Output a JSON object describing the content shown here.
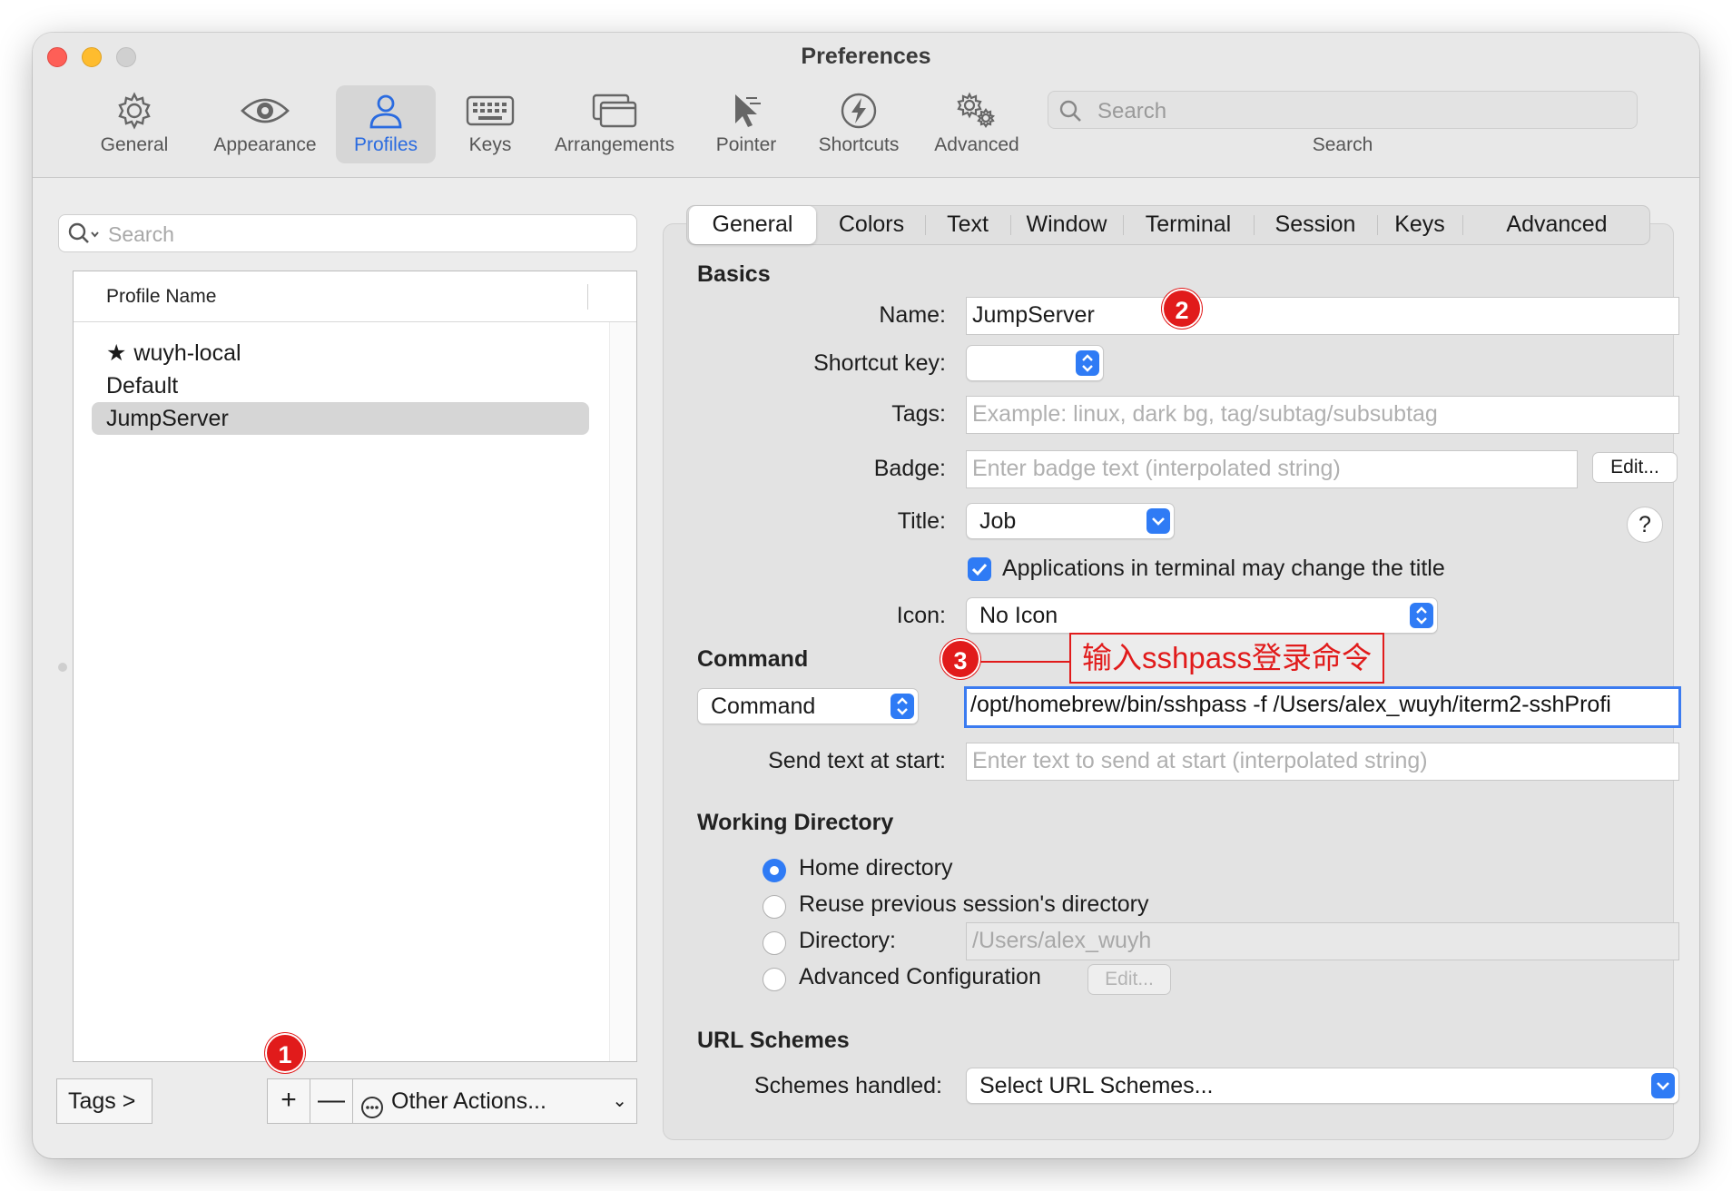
{
  "window": {
    "title": "Preferences"
  },
  "toolbar": {
    "items": [
      {
        "label": "General",
        "icon": "gear-icon"
      },
      {
        "label": "Appearance",
        "icon": "eye-icon"
      },
      {
        "label": "Profiles",
        "icon": "person-icon"
      },
      {
        "label": "Keys",
        "icon": "keyboard-icon"
      },
      {
        "label": "Arrangements",
        "icon": "windows-icon"
      },
      {
        "label": "Pointer",
        "icon": "cursor-icon"
      },
      {
        "label": "Shortcuts",
        "icon": "lightning-icon"
      },
      {
        "label": "Advanced",
        "icon": "gears-icon"
      }
    ],
    "search_placeholder": "Search",
    "search_label": "Search"
  },
  "profiles": {
    "search_placeholder": "Search",
    "column_header": "Profile Name",
    "items": [
      {
        "name": "wuyh-local",
        "default_star": "★"
      },
      {
        "name": "Default"
      },
      {
        "name": "JumpServer"
      }
    ],
    "tags_button": "Tags >",
    "add_button": "+",
    "remove_button": "—",
    "other_actions": "Other Actions...",
    "other_actions_chevron": "⌄"
  },
  "tabs": [
    "General",
    "Colors",
    "Text",
    "Window",
    "Terminal",
    "Session",
    "Keys",
    "Advanced"
  ],
  "basics": {
    "title": "Basics",
    "name_label": "Name:",
    "name_value": "JumpServer",
    "shortcut_label": "Shortcut key:",
    "tags_label": "Tags:",
    "tags_placeholder": "Example: linux, dark bg, tag/subtag/subsubtag",
    "badge_label": "Badge:",
    "badge_placeholder": "Enter badge text (interpolated string)",
    "badge_edit": "Edit...",
    "title_label": "Title:",
    "title_value": "Job",
    "help": "?",
    "apps_change_title": "Applications in terminal may change the title",
    "icon_label": "Icon:",
    "icon_value": "No Icon"
  },
  "command": {
    "title": "Command",
    "type_value": "Command",
    "command_value": "/opt/homebrew/bin/sshpass -f /Users/alex_wuyh/iterm2-sshProfi",
    "send_text_label": "Send text at start:",
    "send_text_placeholder": "Enter text to send at start (interpolated string)"
  },
  "working_directory": {
    "title": "Working Directory",
    "options": [
      "Home directory",
      "Reuse previous session's directory",
      "Directory:",
      "Advanced Configuration"
    ],
    "directory_value": "/Users/alex_wuyh",
    "advanced_edit": "Edit..."
  },
  "url_schemes": {
    "title": "URL Schemes",
    "label": "Schemes handled:",
    "value": "Select URL Schemes..."
  },
  "annotations": {
    "marker1": "1",
    "marker2": "2",
    "marker3": "3",
    "callout3": "输入sshpass登录命令",
    "color": "#e11b1b"
  }
}
